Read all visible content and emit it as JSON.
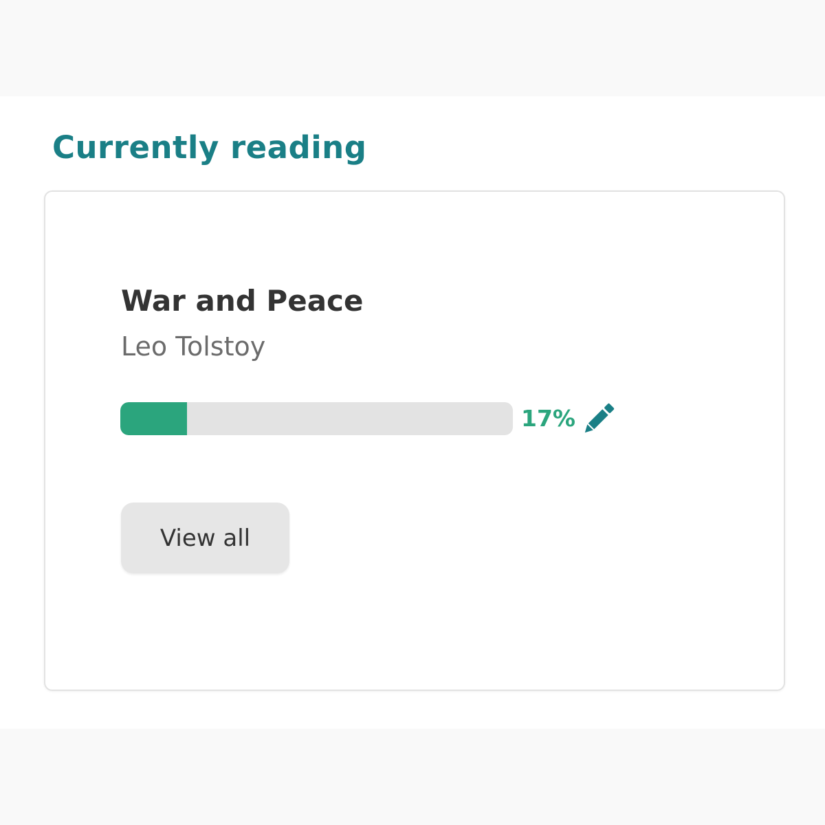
{
  "section": {
    "title": "Currently reading"
  },
  "book": {
    "title": "War and Peace",
    "author": "Leo Tolstoy",
    "progress": 0.17,
    "progress_label": "17%"
  },
  "icons": {
    "edit": "pencil-icon"
  },
  "actions": {
    "view_all_label": "View all"
  },
  "colors": {
    "accent": "#1a7f86",
    "progress": "#2ba57d",
    "track": "#e3e3e3",
    "text_primary": "#333333",
    "text_secondary": "#6b6b6b",
    "button_bg": "#e6e6e6"
  }
}
